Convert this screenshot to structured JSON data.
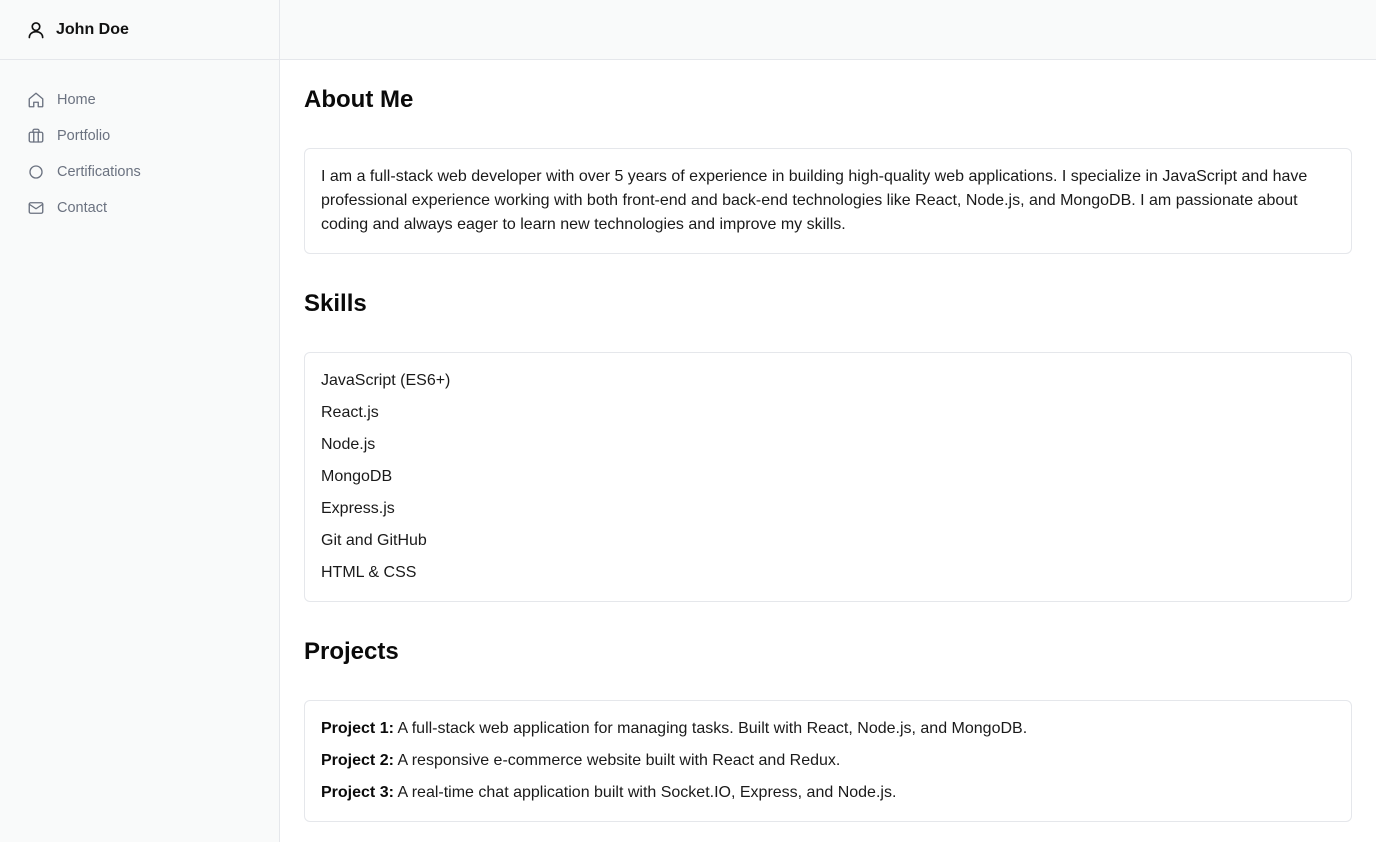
{
  "brand": {
    "name": "John Doe",
    "icon": "user-icon"
  },
  "nav": {
    "items": [
      {
        "label": "Home",
        "icon": "home-icon"
      },
      {
        "label": "Portfolio",
        "icon": "briefcase-icon"
      },
      {
        "label": "Certifications",
        "icon": "circle-icon"
      },
      {
        "label": "Contact",
        "icon": "mail-icon"
      }
    ]
  },
  "about": {
    "title": "About Me",
    "text": "I am a full-stack web developer with over 5 years of experience in building high-quality web applications. I specialize in JavaScript and have professional experience working with both front-end and back-end technologies like React, Node.js, and MongoDB. I am passionate about coding and always eager to learn new technologies and improve my skills."
  },
  "skills": {
    "title": "Skills",
    "items": [
      "JavaScript (ES6+)",
      "React.js",
      "Node.js",
      "MongoDB",
      "Express.js",
      "Git and GitHub",
      "HTML & CSS"
    ]
  },
  "projects": {
    "title": "Projects",
    "items": [
      {
        "name": "Project 1:",
        "description": " A full-stack web application for managing tasks. Built with React, Node.js, and MongoDB."
      },
      {
        "name": "Project 2:",
        "description": " A responsive e-commerce website built with React and Redux."
      },
      {
        "name": "Project 3:",
        "description": " A real-time chat application built with Socket.IO, Express, and Node.js."
      }
    ]
  },
  "colors": {
    "sidebar_bg": "#f9fafa",
    "border": "#e5e7eb",
    "nav_text": "#6b7280"
  }
}
